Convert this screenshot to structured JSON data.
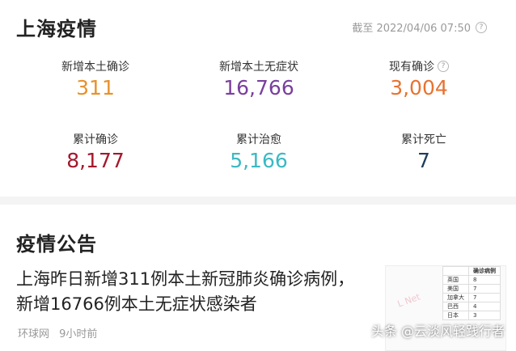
{
  "header": {
    "title": "上海疫情",
    "as_of": "截至 2022/04/06 07:50"
  },
  "stats": [
    {
      "label": "新增本土确诊",
      "value": "311",
      "color": "#e8912b"
    },
    {
      "label": "新增本土无症状",
      "value": "16,766",
      "color": "#7a3f9e"
    },
    {
      "label": "现有确诊",
      "value": "3,004",
      "color": "#e8722f"
    },
    {
      "label": "累计确诊",
      "value": "8,177",
      "color": "#a3192c"
    },
    {
      "label": "累计治愈",
      "value": "5,166",
      "color": "#3ab9c4"
    },
    {
      "label": "累计死亡",
      "value": "7",
      "color": "#1e3c5a"
    }
  ],
  "notice": {
    "title": "疫情公告",
    "headline_line1": "上海昨日新增311例本土新冠肺炎确诊病例，",
    "headline_line2": "新增16766例本土无症状感染者",
    "source": "环球网",
    "time": "9小时前",
    "thumbnail": {
      "header": "确诊病例",
      "rows": [
        {
          "country": "英国",
          "value": "8"
        },
        {
          "country": "美国",
          "value": "7"
        },
        {
          "country": "加拿大",
          "value": "7"
        },
        {
          "country": "巴西",
          "value": "4"
        },
        {
          "country": "日本",
          "value": "3"
        }
      ]
    }
  },
  "watermark": "头条 @云淡风轻践行者"
}
